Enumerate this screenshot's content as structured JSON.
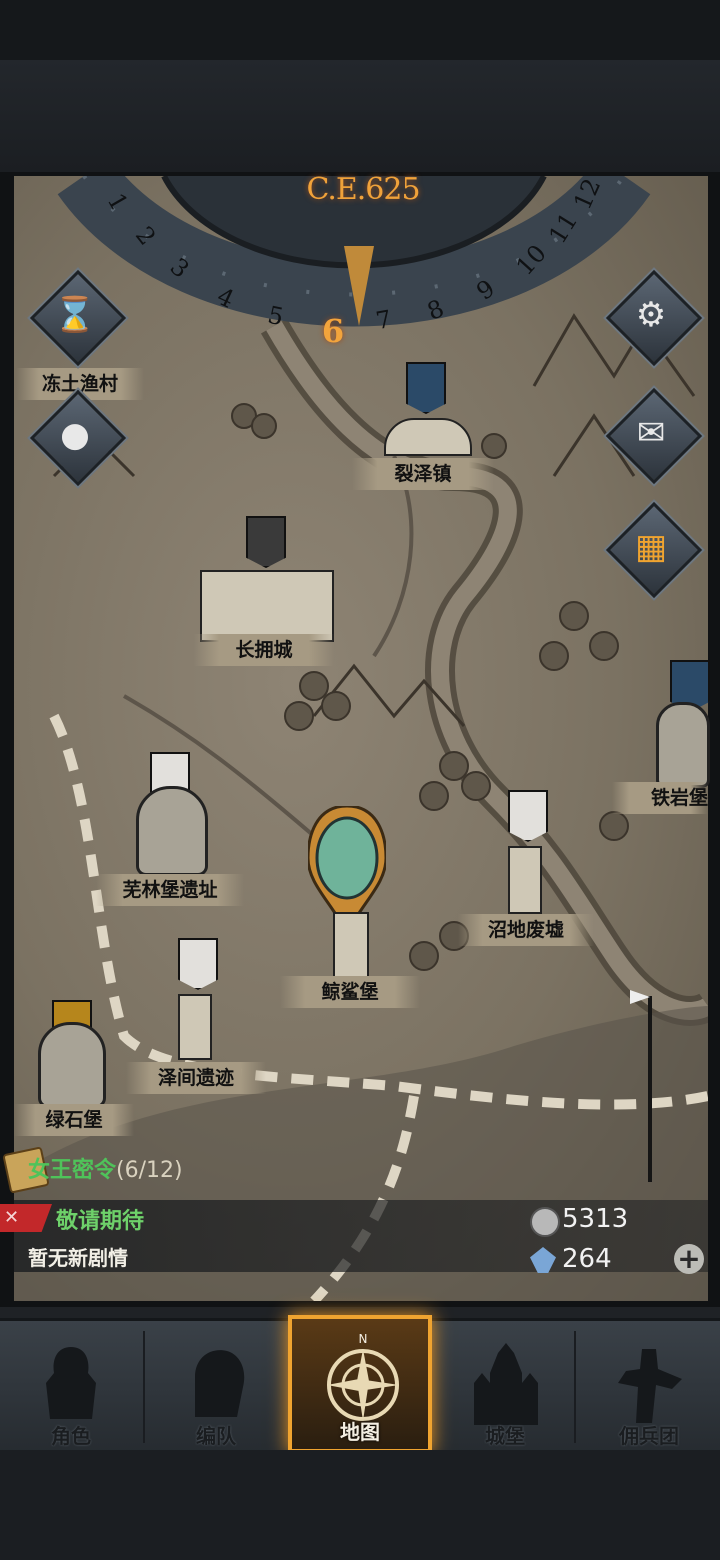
{
  "calendar": {
    "year": "C.E.625",
    "current_month": "6",
    "months": [
      "1",
      "2",
      "3",
      "4",
      "5",
      "7",
      "8",
      "9",
      "10",
      "11",
      "12"
    ]
  },
  "locations": [
    {
      "name": "冻土渔村"
    },
    {
      "name": "裂泽镇"
    },
    {
      "name": "长拥城"
    },
    {
      "name": "铁岩堡"
    },
    {
      "name": "芜林堡遗址"
    },
    {
      "name": "鲸鲨堡"
    },
    {
      "name": "沼地废墟"
    },
    {
      "name": "泽间遗迹"
    },
    {
      "name": "绿石堡"
    }
  ],
  "side_buttons": {
    "left": [
      "hourglass-icon",
      "bag-icon"
    ],
    "right": [
      "gear-icon",
      "mail-icon",
      "grid-icon"
    ]
  },
  "quest": {
    "title": "女王密令",
    "count": "(6/12)"
  },
  "story": {
    "title": "敬请期待",
    "subtitle": "暂无新剧情"
  },
  "resources": {
    "silver": "5313",
    "crystal": "264"
  },
  "nav": {
    "items": [
      {
        "label": "角色"
      },
      {
        "label": "编队"
      },
      {
        "label": "地图"
      },
      {
        "label": "城堡"
      },
      {
        "label": "佣兵团"
      }
    ]
  },
  "colors": {
    "accent": "#f0a430",
    "quest": "#4fc35a",
    "map": "#7b7262"
  }
}
